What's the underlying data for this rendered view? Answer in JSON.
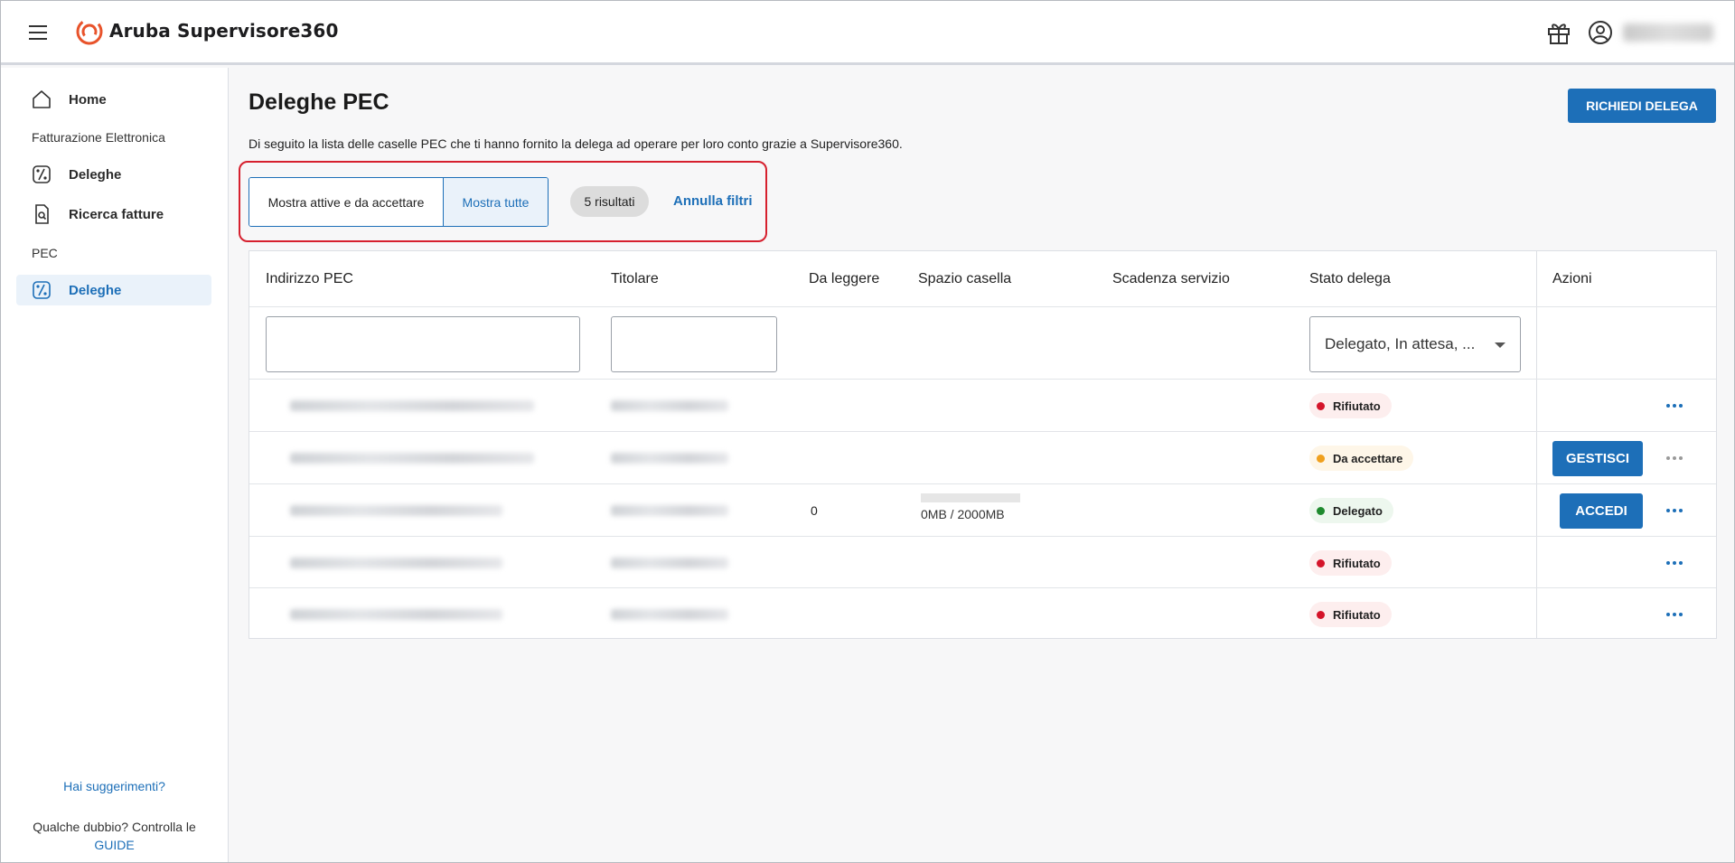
{
  "header": {
    "app_title": "Aruba Supervisore360",
    "menu_icon": "hamburger-icon",
    "gift_icon": "gift-icon",
    "account_icon": "user-circle-icon",
    "brand_color": "#e8532b"
  },
  "sidebar": {
    "home": "Home",
    "section_fatturazione": "Fatturazione Elettronica",
    "fe_deleghe": "Deleghe",
    "ricerca_fatture": "Ricerca fatture",
    "section_pec": "PEC",
    "pec_deleghe": "Deleghe",
    "feedback": "Hai suggerimenti?",
    "help_prefix": "Qualche dubbio? Controlla le",
    "help_link": "GUIDE"
  },
  "main": {
    "title": "Deleghe PEC",
    "request_button": "RICHIEDI DELEGA",
    "intro": "Di seguito la lista delle caselle PEC che ti hanno fornito la delega ad operare per loro conto grazie a Supervisore360.",
    "filter_active": "Mostra attive e da accettare",
    "filter_all": "Mostra tutte",
    "results": "5 risultati",
    "clear_filters": "Annulla filtri"
  },
  "table": {
    "headers": {
      "pec": "Indirizzo PEC",
      "owner": "Titolare",
      "unread": "Da leggere",
      "space": "Spazio casella",
      "expiry": "Scadenza servizio",
      "status": "Stato delega",
      "actions": "Azioni"
    },
    "status_filter": "Delegato, In attesa, ...",
    "rows": [
      {
        "status": "Rifiutato",
        "unread": "",
        "space": "",
        "action": ""
      },
      {
        "status": "Da accettare",
        "unread": "",
        "space": "",
        "action": "GESTISCI"
      },
      {
        "status": "Delegato",
        "unread": "0",
        "space": "0MB / 2000MB",
        "space_used_fraction": 0,
        "action": "ACCEDI"
      },
      {
        "status": "Rifiutato",
        "unread": "",
        "space": "",
        "action": ""
      },
      {
        "status": "Rifiutato",
        "unread": "",
        "space": "",
        "action": ""
      }
    ],
    "status_colors": {
      "Rifiutato": "#d4142a",
      "Da accettare": "#f0a01e",
      "Delegato": "#1e8a2e"
    }
  }
}
